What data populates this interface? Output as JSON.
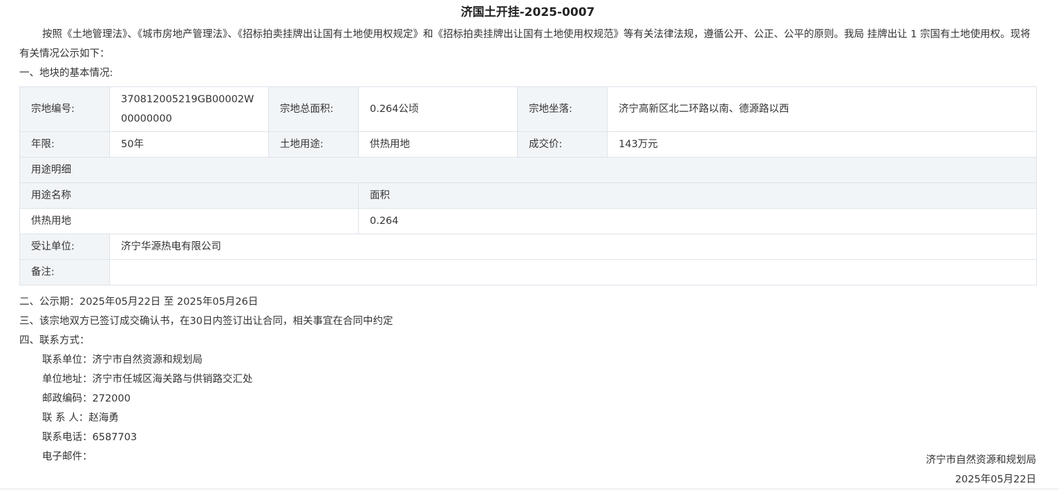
{
  "title": "济国土开挂-2025-0007",
  "intro": "按照《土地管理法》、《城市房地产管理法》、《招标拍卖挂牌出让国有土地使用权规定》和《招标拍卖挂牌出让国有土地使用权规范》等有关法律法规，遵循公开、公正、公平的原则。我局 挂牌出让 1 宗国有土地使用权。现将有关情况公示如下：",
  "section1": "一、地块的基本情况:",
  "table": {
    "r1": {
      "l1": "宗地编号:",
      "v1": "370812005219GB00002W00000000",
      "l2": "宗地总面积:",
      "v2": "0.264公顷",
      "l3": "宗地坐落:",
      "v3": "济宁高新区北二环路以南、德源路以西"
    },
    "r2": {
      "l1": "年限:",
      "v1": "50年",
      "l2": "土地用途:",
      "v2": "供热用地",
      "l3": "成交价:",
      "v3": "143万元"
    },
    "usage_detail": "用途明细",
    "usage_head": {
      "name": "用途名称",
      "area": "面积"
    },
    "usage_row": {
      "name": "供热用地",
      "area": "0.264"
    },
    "transferee_label": "受让单位:",
    "transferee": "济宁华源热电有限公司",
    "remark_label": "备注:",
    "remark": ""
  },
  "section2": "二、公示期：2025年05月22日 至 2025年05月26日",
  "section3": "三、该宗地双方已签订成交确认书，在30日内签订出让合同，相关事宜在合同中约定",
  "section4": "四、联系方式：",
  "contact": {
    "unit": "联系单位：济宁市自然资源和规划局",
    "address": "单位地址：济宁市任城区海关路与供销路交汇处",
    "postcode": "邮政编码：272000",
    "person": "联 系 人：赵海勇",
    "phone": "联系电话：6587703",
    "email": "电子邮件："
  },
  "signature": {
    "org": "济宁市自然资源和规划局",
    "date": "2025年05月22日"
  }
}
